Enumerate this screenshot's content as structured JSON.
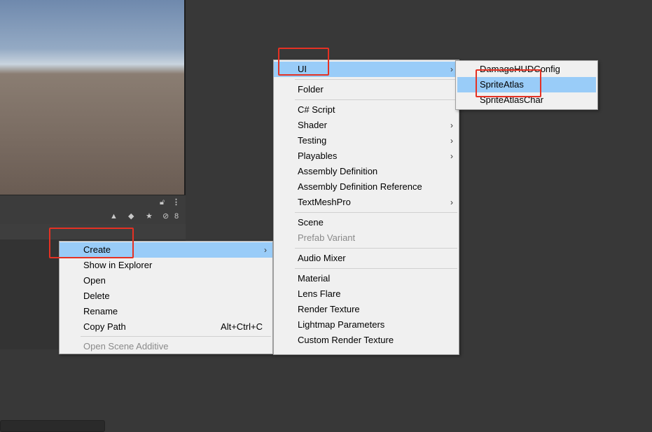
{
  "project_toolbar": {
    "hidden_count": "8"
  },
  "context_menu": [
    {
      "label": "Create",
      "submenu": true,
      "selected": true
    },
    {
      "label": "Show in Explorer"
    },
    {
      "label": "Open"
    },
    {
      "label": "Delete"
    },
    {
      "label": "Rename"
    },
    {
      "label": "Copy Path",
      "shortcut": "Alt+Ctrl+C"
    },
    {
      "label": "Open Scene Additive",
      "disabled": true
    }
  ],
  "create_menu": {
    "ui": "UI",
    "folder": "Folder",
    "csharp_script": "C# Script",
    "shader": "Shader",
    "testing": "Testing",
    "playables": "Playables",
    "assembly_definition": "Assembly Definition",
    "assembly_definition_reference": "Assembly Definition Reference",
    "textmeshpro": "TextMeshPro",
    "scene": "Scene",
    "prefab_variant": "Prefab Variant",
    "audio_mixer": "Audio Mixer",
    "material": "Material",
    "lens_flare": "Lens Flare",
    "render_texture": "Render Texture",
    "lightmap_parameters": "Lightmap Parameters",
    "custom_render_texture": "Custom Render Texture"
  },
  "ui_submenu": {
    "damage_hud_config": "DamageHUDConfig",
    "sprite_atlas": "SpriteAtlas",
    "sprite_atlas_char": "SpriteAtlasChar"
  },
  "colors": {
    "highlight": "#99ccf8",
    "annotation": "#e53123",
    "editor_bg": "#383838",
    "menu_bg": "#f0f0f0"
  }
}
